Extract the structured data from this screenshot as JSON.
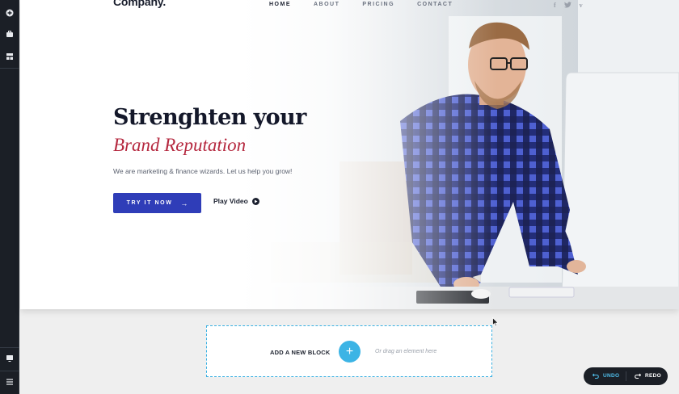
{
  "sidebar": {
    "top_icons": [
      "add-circle-icon",
      "briefcase-icon",
      "layout-icon"
    ],
    "bottom_icons": [
      "monitor-icon",
      "menu-icon"
    ]
  },
  "site": {
    "logo": "Company.",
    "nav": [
      "HOME",
      "ABOUT",
      "PRICING",
      "CONTACT"
    ],
    "active_nav": "HOME",
    "social": [
      "f",
      "t",
      "v"
    ]
  },
  "hero": {
    "title_line1": "Strenghten your",
    "title_line2": "Brand Reputation",
    "subtitle": "We are marketing & finance wizards. Let us help you grow!",
    "cta_label": "TRY IT NOW",
    "cta_arrow": "→",
    "play_label": "Play Video"
  },
  "add_block": {
    "label": "ADD A NEW BLOCK",
    "plus": "+",
    "hint": "Or drag an element here"
  },
  "history": {
    "undo": "UNDO",
    "redo": "REDO"
  },
  "colors": {
    "accent_blue": "#2f3db8",
    "title_red": "#b5283f",
    "plus_blue": "#3cb4e5",
    "sidebar": "#1b1f26"
  }
}
